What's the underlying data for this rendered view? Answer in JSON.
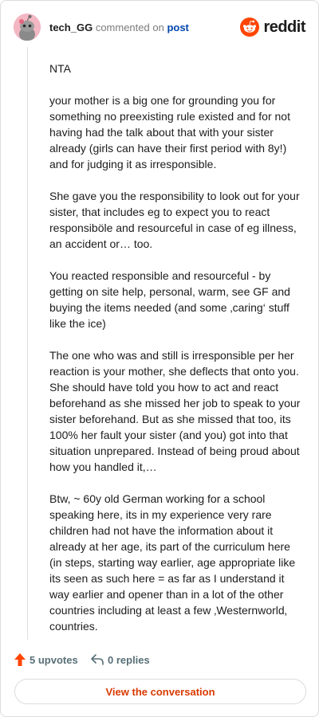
{
  "header": {
    "username": "tech_GG",
    "action": "commented on",
    "post_link": "post",
    "brand": "reddit",
    "avatar_icon": "snoo-avatar-icon",
    "logo_icon": "reddit-snoo-icon"
  },
  "comment": {
    "paragraphs": [
      "NTA",
      "your mother is a big one for grounding you for something no preexisting rule existed and for not having had the talk about that with your sister already (girls can have their first period with 8y!) and for judging it as irresponsible.",
      "She gave you the responsibility to look out for your sister, that includes eg to expect you to react responsiböle and resourceful in case of eg illness, an accident or… too.",
      "You reacted responsible and resourceful - by getting on site help, personal, warm, see GF and buying the items needed (and some ‚caring‘ stuff like the ice)",
      "The one who was and still is irresponsible per her reaction is your mother, she deflects that onto you. She should have told you how to act and react beforehand as she missed her job to speak to your sister beforehand. But as she missed that too, its 100% her fault your sister (and you) got into that situation unprepared. Instead of being proud about how you handled it,…",
      "Btw, ~ 60y old German working for a school speaking here, its in my experience very rare children had not have the information about it already at her age, its part of the curriculum here (in steps, starting way earlier, age appropriate like its seen as such here = as far as I understand it way earlier and opener than in a lot of the other countries including at least a few ‚Westernworld‚ countries."
    ]
  },
  "footer": {
    "upvotes": "5 upvotes",
    "replies": "0 replies",
    "upvote_icon": "upvote-arrow-icon",
    "reply_icon": "reply-arrow-icon"
  },
  "cta": {
    "label": "View the conversation"
  },
  "colors": {
    "accent": "#ff4500",
    "cta_text": "#d93a00",
    "link": "#0045ac",
    "muted": "#576f76"
  }
}
